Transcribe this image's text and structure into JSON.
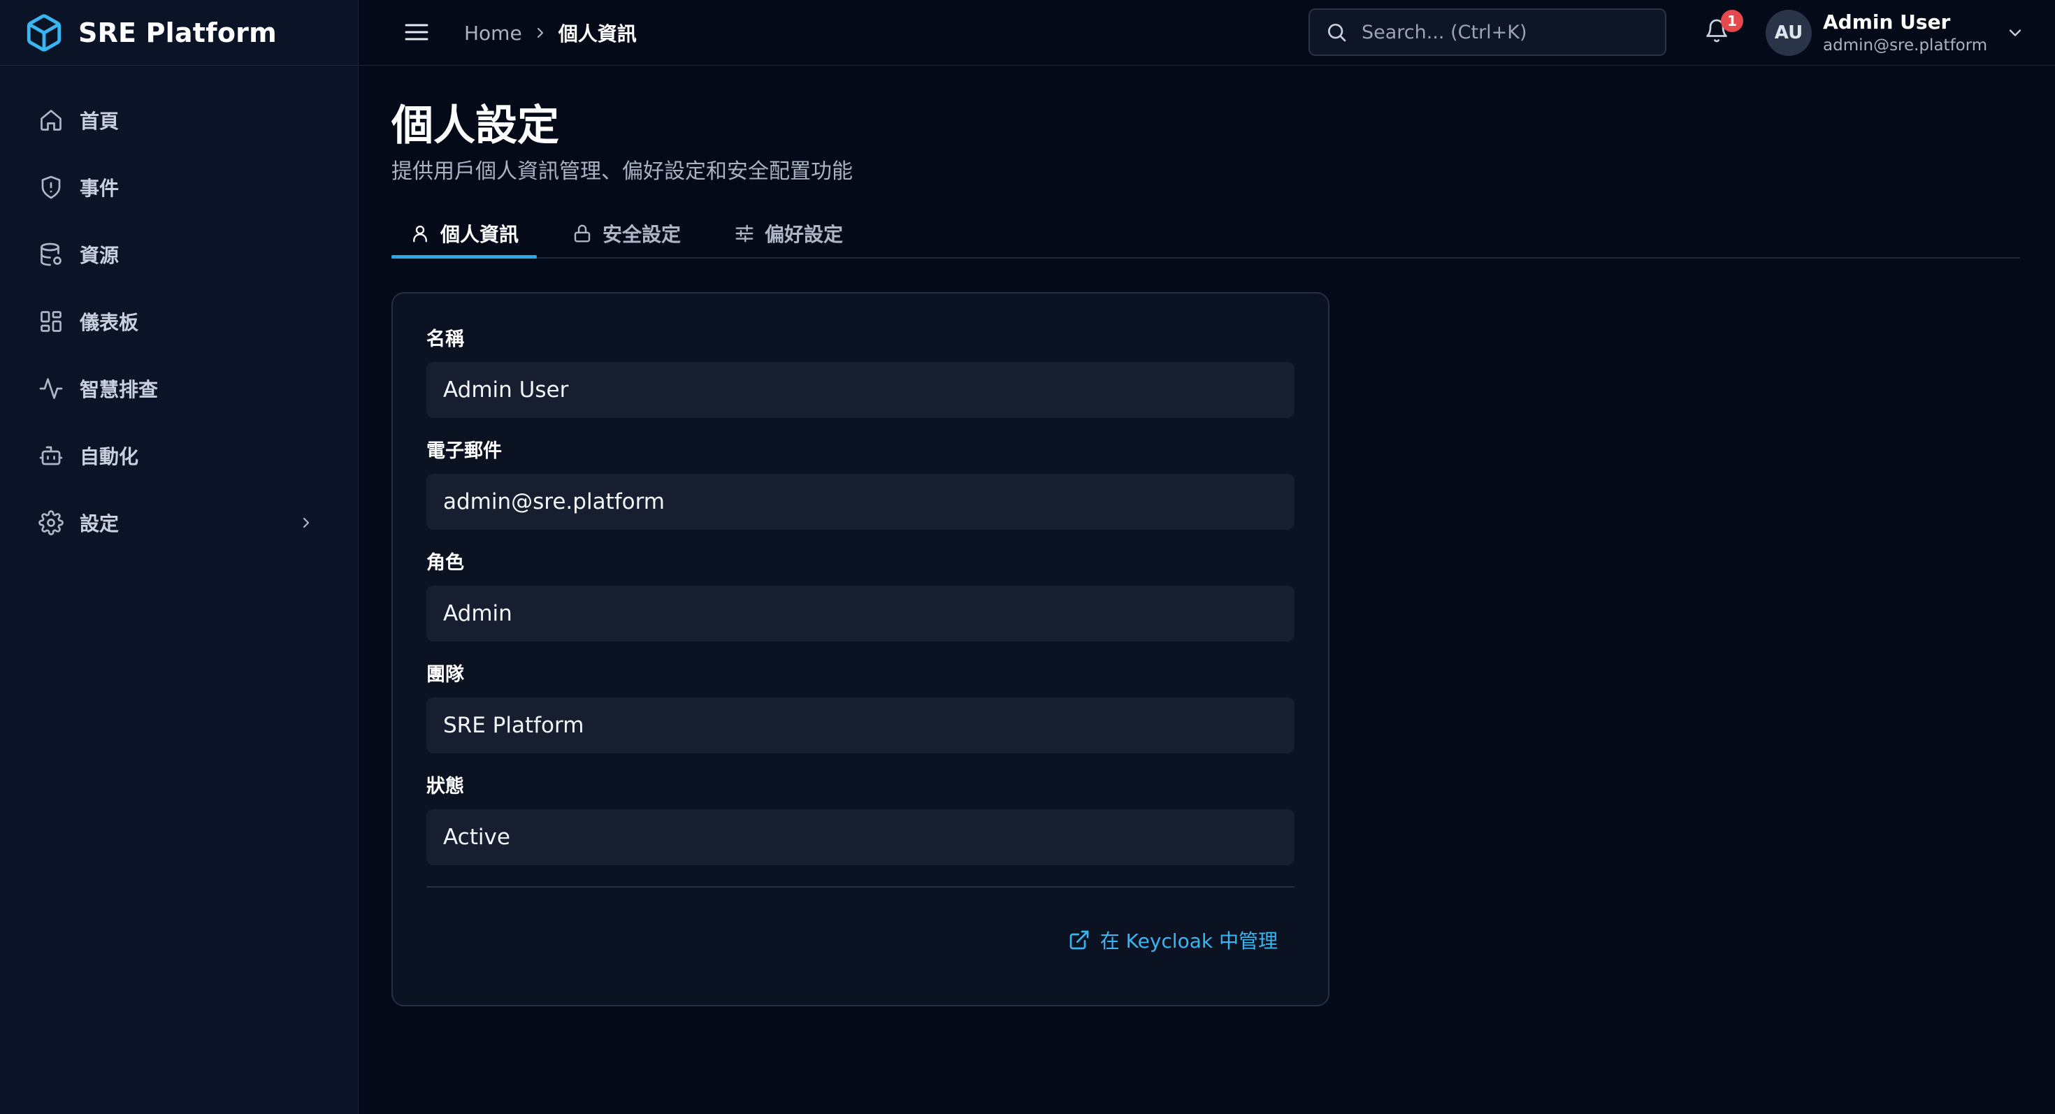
{
  "brand": {
    "name": "SRE Platform"
  },
  "sidebar": {
    "items": [
      {
        "label": "首頁",
        "icon": "home-icon"
      },
      {
        "label": "事件",
        "icon": "shield-alert-icon"
      },
      {
        "label": "資源",
        "icon": "database-icon"
      },
      {
        "label": "儀表板",
        "icon": "dashboard-grid-icon"
      },
      {
        "label": "智慧排查",
        "icon": "activity-pulse-icon"
      },
      {
        "label": "自動化",
        "icon": "bot-icon"
      },
      {
        "label": "設定",
        "icon": "gear-icon",
        "has_submenu": true
      }
    ]
  },
  "header": {
    "breadcrumb": {
      "home": "Home",
      "current": "個人資訊"
    },
    "search": {
      "placeholder": "Search... (Ctrl+K)"
    },
    "notifications": {
      "count": "1"
    },
    "user": {
      "initials": "AU",
      "name": "Admin User",
      "email": "admin@sre.platform"
    }
  },
  "page": {
    "title": "個人設定",
    "subtitle": "提供用戶個人資訊管理、偏好設定和安全配置功能"
  },
  "tabs": [
    {
      "label": "個人資訊",
      "icon": "user-icon",
      "active": true
    },
    {
      "label": "安全設定",
      "icon": "lock-icon",
      "active": false
    },
    {
      "label": "偏好設定",
      "icon": "sliders-icon",
      "active": false
    }
  ],
  "profile": {
    "fields": [
      {
        "label": "名稱",
        "value": "Admin User"
      },
      {
        "label": "電子郵件",
        "value": "admin@sre.platform"
      },
      {
        "label": "角色",
        "value": "Admin"
      },
      {
        "label": "團隊",
        "value": "SRE Platform"
      },
      {
        "label": "狀態",
        "value": "Active"
      }
    ],
    "keycloak_link": "在 Keycloak 中管理"
  },
  "colors": {
    "background": "#040a18",
    "sidebar": "#0b1426",
    "accent": "#2aa9e8",
    "link": "#38b6f2",
    "badge": "#e5484d"
  }
}
